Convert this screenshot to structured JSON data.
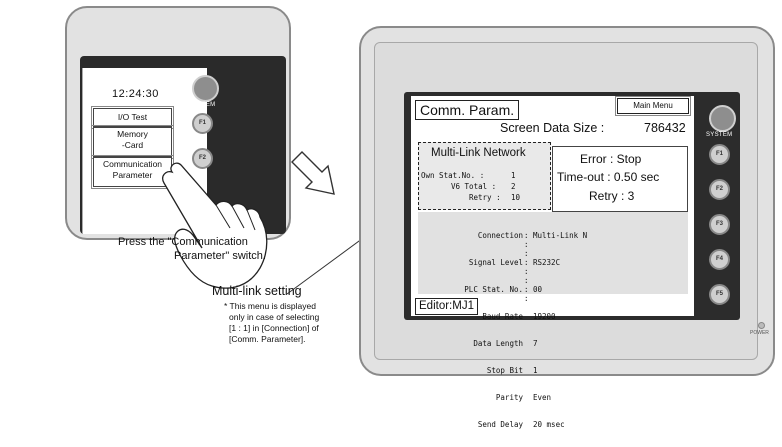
{
  "left_device": {
    "clock": "12:24:30",
    "system_label": "SYSTEM",
    "buttons": [
      "I/O Test",
      "Memory",
      "-Card",
      "Communication",
      "Parameter"
    ],
    "f1": "F1",
    "f2": "F2"
  },
  "caption_press": [
    "Press the \"Communication",
    "Parameter\" switch."
  ],
  "caption_multilink": "Multi-link setting",
  "note_lines": [
    "* This menu is displayed",
    "only in case of selecting",
    "[1 : 1] in [Connection] of",
    "[Comm. Parameter]."
  ],
  "right_device": {
    "title": "Comm. Param.",
    "main_menu": "Main Menu",
    "screen_data_size_label": "Screen Data Size :",
    "screen_data_size_value": "786432",
    "multilink": {
      "title": "Multi-Link Network",
      "rows": [
        {
          "label": "Own Stat.No. :",
          "value": "1"
        },
        {
          "label": "V6 Total :",
          "value": "2"
        },
        {
          "label": "Retry :",
          "value": "10"
        }
      ]
    },
    "error_box": {
      "error": "Error : Stop",
      "timeout": "Time-out : 0.50 sec",
      "retry": "Retry : 3"
    },
    "settings": [
      {
        "label": "Connection",
        "value": "Multi-Link N"
      },
      {
        "label": "Signal Level",
        "value": "RS232C"
      },
      {
        "label": "PLC Stat. No.",
        "value": "00"
      },
      {
        "label": "Baud Rate",
        "value": "19200"
      },
      {
        "label": "Data Length",
        "value": "7"
      },
      {
        "label": "Stop Bit",
        "value": "1"
      },
      {
        "label": "Parity",
        "value": "Even"
      },
      {
        "label": "Send Delay",
        "value": "20 msec"
      }
    ],
    "editor": "Editor:MJ1",
    "system_label": "SYSTEM",
    "function_keys": [
      "F1",
      "F2",
      "F3",
      "F4",
      "F5"
    ],
    "power_label": "POWER"
  }
}
